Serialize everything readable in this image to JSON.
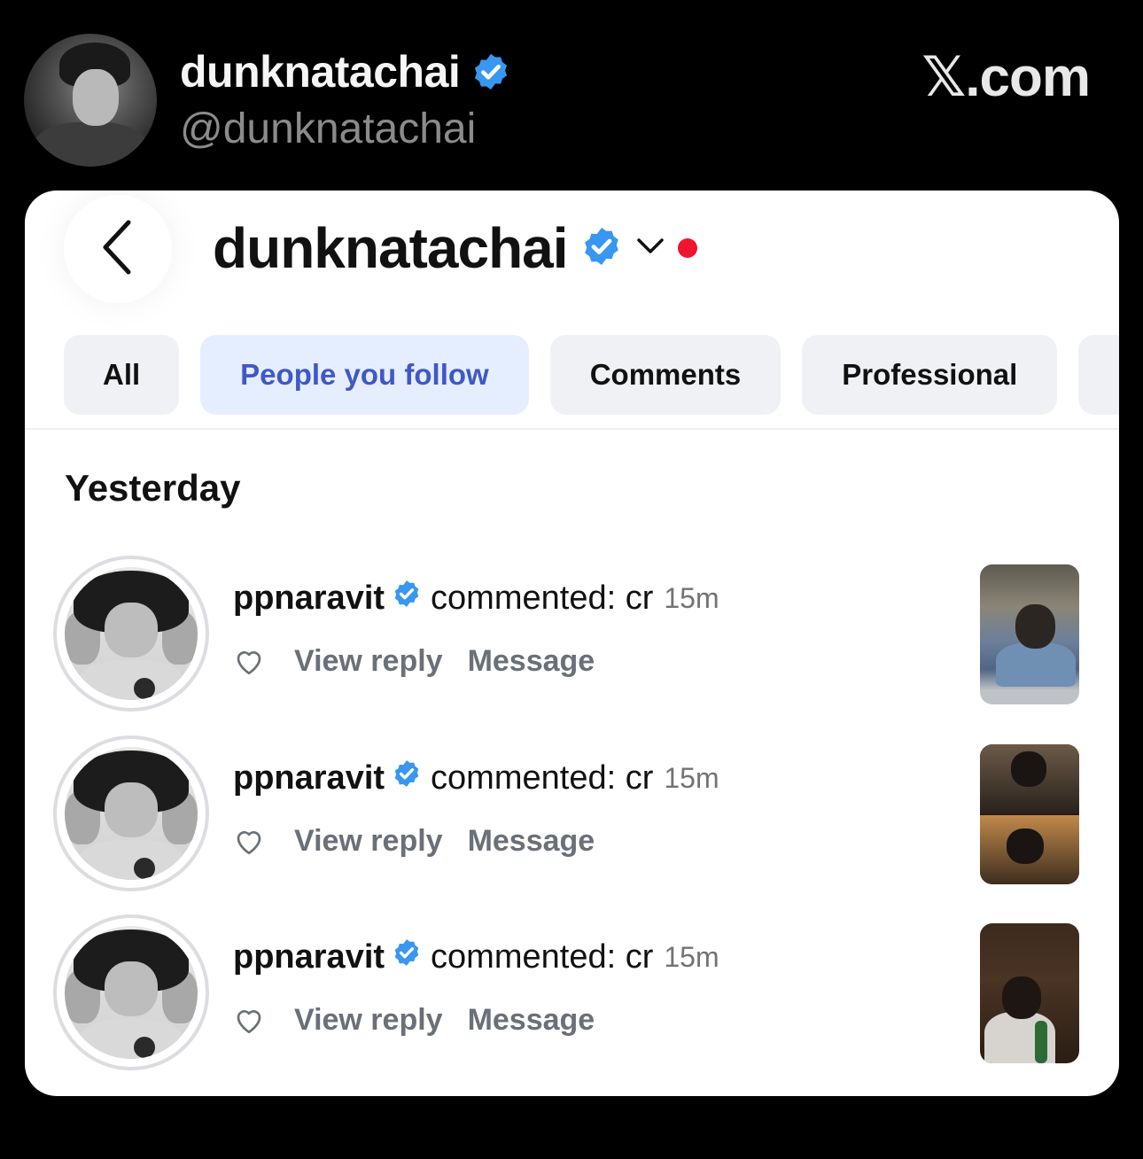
{
  "x_post": {
    "display_name": "dunknatachai",
    "handle": "@dunknatachai",
    "brand": "𝕏.com"
  },
  "instagram": {
    "account_name": "dunknatachai",
    "tabs": [
      {
        "label": "All",
        "active": false
      },
      {
        "label": "People you follow",
        "active": true
      },
      {
        "label": "Comments",
        "active": false
      },
      {
        "label": "Professional",
        "active": false
      }
    ],
    "section_title": "Yesterday",
    "notifications": [
      {
        "username": "ppnaravit",
        "action": "commented: cr",
        "time": "15m",
        "view_reply": "View reply",
        "message": "Message"
      },
      {
        "username": "ppnaravit",
        "action": "commented: cr",
        "time": "15m",
        "view_reply": "View reply",
        "message": "Message"
      },
      {
        "username": "ppnaravit",
        "action": "commented: cr",
        "time": "15m",
        "view_reply": "View reply",
        "message": "Message"
      }
    ]
  },
  "colors": {
    "verified_blue": "#3897f0",
    "active_tab_text": "#4058c6",
    "active_tab_bg": "#e5eefe",
    "notification_dot": "#f0142f"
  },
  "icons": [
    "verified-badge-icon",
    "back-chevron-icon",
    "chevron-down-icon",
    "heart-outline-icon"
  ]
}
